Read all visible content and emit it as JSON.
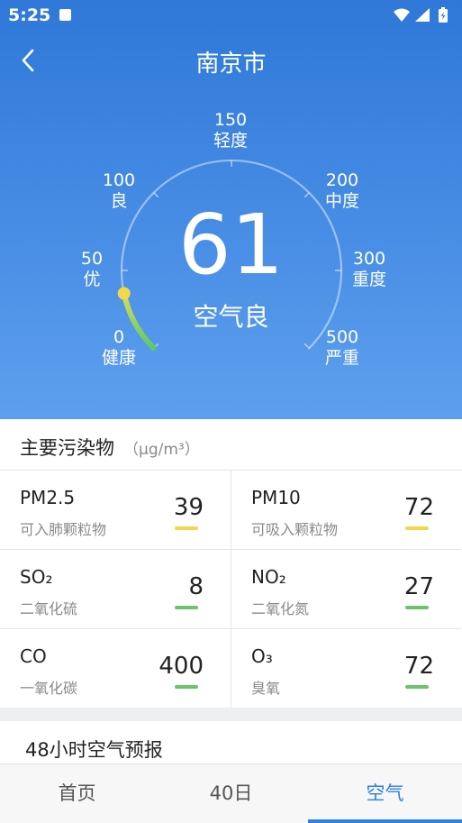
{
  "status_bar": {
    "time": "5:25"
  },
  "header": {
    "title": "南京市"
  },
  "gauge": {
    "aqi": "61",
    "quality": "空气良",
    "level_fraction": 0.122,
    "labels": [
      {
        "value": "0",
        "name": "健康"
      },
      {
        "value": "50",
        "name": "优"
      },
      {
        "value": "100",
        "name": "良"
      },
      {
        "value": "150",
        "name": "轻度"
      },
      {
        "value": "200",
        "name": "中度"
      },
      {
        "value": "300",
        "name": "重度"
      },
      {
        "value": "500",
        "name": "严重"
      }
    ]
  },
  "pollutants": {
    "title": "主要污染物",
    "unit": "（μg/m³）",
    "items": [
      {
        "name": "PM2.5",
        "cn": "可入肺颗粒物",
        "value": "39",
        "color": "#f5d44a"
      },
      {
        "name": "PM10",
        "cn": "可吸入颗粒物",
        "value": "72",
        "color": "#f5d44a"
      },
      {
        "name": "SO₂",
        "cn": "二氧化硫",
        "value": "8",
        "color": "#6cc46a"
      },
      {
        "name": "NO₂",
        "cn": "二氧化氮",
        "value": "27",
        "color": "#6cc46a"
      },
      {
        "name": "CO",
        "cn": "一氧化碳",
        "value": "400",
        "color": "#6cc46a"
      },
      {
        "name": "O₃",
        "cn": "臭氧",
        "value": "72",
        "color": "#6cc46a"
      }
    ]
  },
  "forecast": {
    "title": "48小时空气预报"
  },
  "nav": {
    "tabs": [
      {
        "label": "首页"
      },
      {
        "label": "40日"
      },
      {
        "label": "空气"
      }
    ],
    "active": 2
  }
}
